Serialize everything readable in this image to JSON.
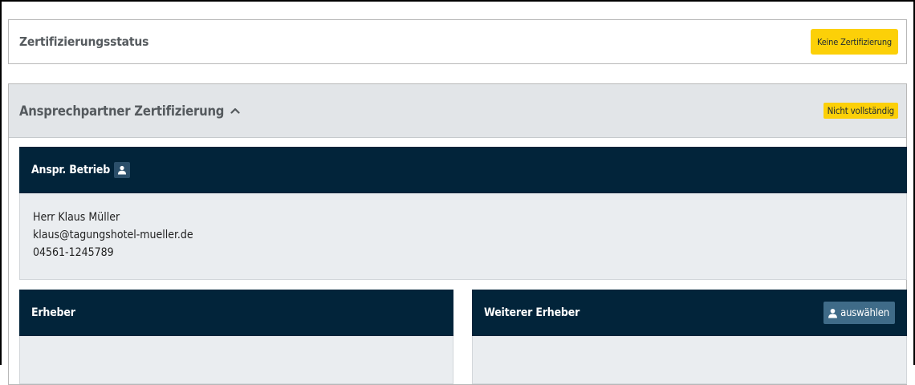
{
  "certification": {
    "title": "Zertifizierungsstatus",
    "status_button": "Keine Zertifizierung"
  },
  "contact_section": {
    "title": "Ansprechpartner Zertifizierung",
    "status_badge": "Nicht vollständig",
    "business_contact": {
      "title": "Anspr. Betrieb",
      "name": "Herr Klaus Müller",
      "email": "klaus@tagungshotel-mueller.de",
      "phone": "04561-1245789"
    },
    "collector": {
      "title": "Erheber"
    },
    "additional_collector": {
      "title": "Weiterer Erheber",
      "select_button": "auswählen"
    }
  },
  "colors": {
    "accent_yellow": "#fcd008",
    "dark_navy": "#02243a",
    "button_blue": "#3f6b88",
    "section_header_gray": "#e2e5e8"
  },
  "icons": [
    "person-icon",
    "chevron-up-icon"
  ]
}
